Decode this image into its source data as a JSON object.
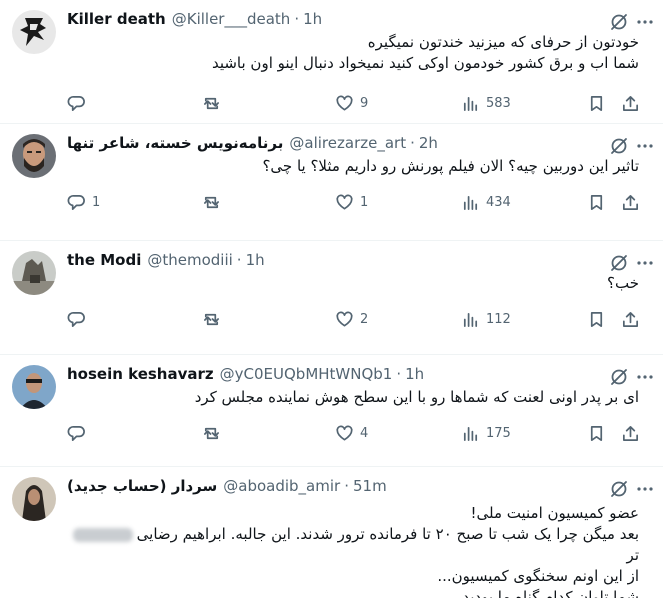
{
  "tweets": [
    {
      "name": "Killer death",
      "handle": "@Killer___death",
      "dot": "·",
      "time": "1h",
      "lines": [
        "خودتون از حرفای که میزنید خندتون نمیگیره",
        "شما اب و برق کشور خودمون اوکی کنید نمیخواد دنبال اینو اون باشید"
      ],
      "replies": "",
      "retweets": "",
      "likes": "9",
      "views": "583"
    },
    {
      "name": "برنامه‌نویس خسته، شاعر تنها",
      "handle": "@alirezarze_art",
      "dot": "·",
      "time": "2h",
      "lines": [
        "تاثیر این دوربین چیه؟ الان فیلم پورنش رو داریم مثلا؟ یا چی؟"
      ],
      "replies": "1",
      "retweets": "",
      "likes": "1",
      "views": "434"
    },
    {
      "name": "the Modi",
      "handle": "@themodiii",
      "dot": "·",
      "time": "1h",
      "lines": [
        "خب؟"
      ],
      "replies": "",
      "retweets": "",
      "likes": "2",
      "views": "112"
    },
    {
      "name": "hosein keshavarz",
      "handle": "@yC0EUQbMHtWNQb1",
      "dot": "·",
      "time": "1h",
      "lines": [
        "ای بر پدر اونی لعنت که شماها رو با این سطح هوش نماینده مجلس کرد"
      ],
      "replies": "",
      "retweets": "",
      "likes": "4",
      "views": "175"
    },
    {
      "name": "سردار (حساب جدید)",
      "handle": "@aboadib_amir",
      "dot": "·",
      "time": "51m",
      "line1": "عضو کمیسیون امنیت ملی!",
      "line2": "بعد میگن چرا یک شب تا صبح ۲۰ تا فرمانده ترور شدند. این جالبه. ابراهیم رضایی",
      "line2_end": "تر",
      "line3": "از این اونم سخنگوی کمیسیون...",
      "line4": "شما تاوان کدام گناه ما بودید"
    }
  ],
  "icons": {
    "grok": "grok-icon",
    "more": "more-options-icon",
    "reply": "reply-icon",
    "retweet": "retweet-icon",
    "like": "heart-icon",
    "views": "views-chart-icon",
    "bookmark": "bookmark-icon",
    "share": "share-icon"
  }
}
